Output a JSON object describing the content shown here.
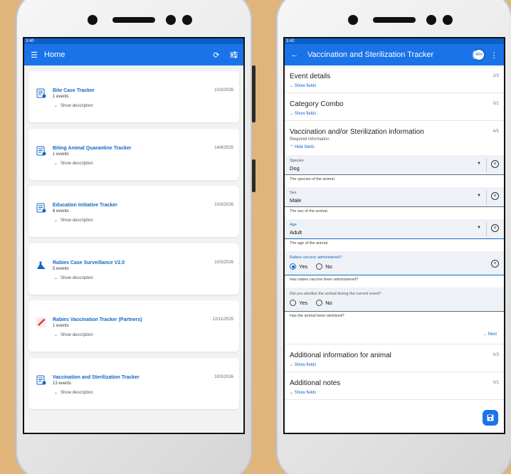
{
  "left": {
    "status_time": "3:40",
    "appbar": {
      "title": "Home"
    },
    "cards": [
      {
        "name": "Bite Case Tracker",
        "events": "1 events",
        "date": "10/3/2026",
        "desc": "Show description",
        "icon": "document-form-icon"
      },
      {
        "name": "Biting Animal Quarantine Tracker",
        "events": "1 events",
        "date": "14/8/2025",
        "desc": "Show description",
        "icon": "document-form-icon"
      },
      {
        "name": "Education Initiative Tracker",
        "events": "6 events",
        "date": "10/3/2026",
        "desc": "Show description",
        "icon": "document-form-icon"
      },
      {
        "name": "Rabies Case Surveillance V2.0",
        "events": "5 events",
        "date": "10/3/2026",
        "desc": "Show description",
        "icon": "surveillance-icon"
      },
      {
        "name": "Rabies Vaccination Tracker (Partners)",
        "events": "1 events",
        "date": "12/11/2025",
        "desc": "Show description",
        "icon": "syringe-icon"
      },
      {
        "name": "Vaccination and Sterilization Tracker",
        "events": "13 events",
        "date": "10/3/2026",
        "desc": "Show description",
        "icon": "document-form-icon"
      }
    ]
  },
  "right": {
    "status_time": "3:42",
    "appbar": {
      "title": "Vaccination and Sterilization Tracker",
      "progress": "46%"
    },
    "sections": {
      "event_details": {
        "title": "Event details",
        "count": "2/3",
        "toggle": "Show fields"
      },
      "category_combo": {
        "title": "Category Combo",
        "count": "0/1",
        "toggle": "Show fields"
      },
      "vacc_info": {
        "title": "Vaccination and/or Sterilization information",
        "count": "4/5",
        "sub": "Required information",
        "toggle": "Hide fields"
      },
      "additional_info": {
        "title": "Additional information for animal",
        "count": "0/3",
        "toggle": "Show fields"
      },
      "additional_notes": {
        "title": "Additional notes",
        "count": "0/1",
        "toggle": "Show fields"
      }
    },
    "fields": {
      "species": {
        "label": "Species",
        "value": "Dog",
        "help": "The species of the animal."
      },
      "sex": {
        "label": "Sex",
        "value": "Male",
        "help": "The sex of the animal."
      },
      "age": {
        "label": "Age",
        "value": "Adult",
        "help": "The age of the animal"
      },
      "rabies": {
        "label": "Rabies vaccine administered?",
        "yes": "Yes",
        "no": "No",
        "help": "Has rabies vaccine been administered?"
      },
      "sterilize": {
        "label": "Did you sterilize the animal during the current event?",
        "yes": "Yes",
        "no": "No",
        "help": "Has the animal been sterilized?"
      }
    },
    "next_label": "Next"
  },
  "colors": {
    "primary": "#1a73e8",
    "link": "#1466c4",
    "background": "#e1b47c"
  }
}
